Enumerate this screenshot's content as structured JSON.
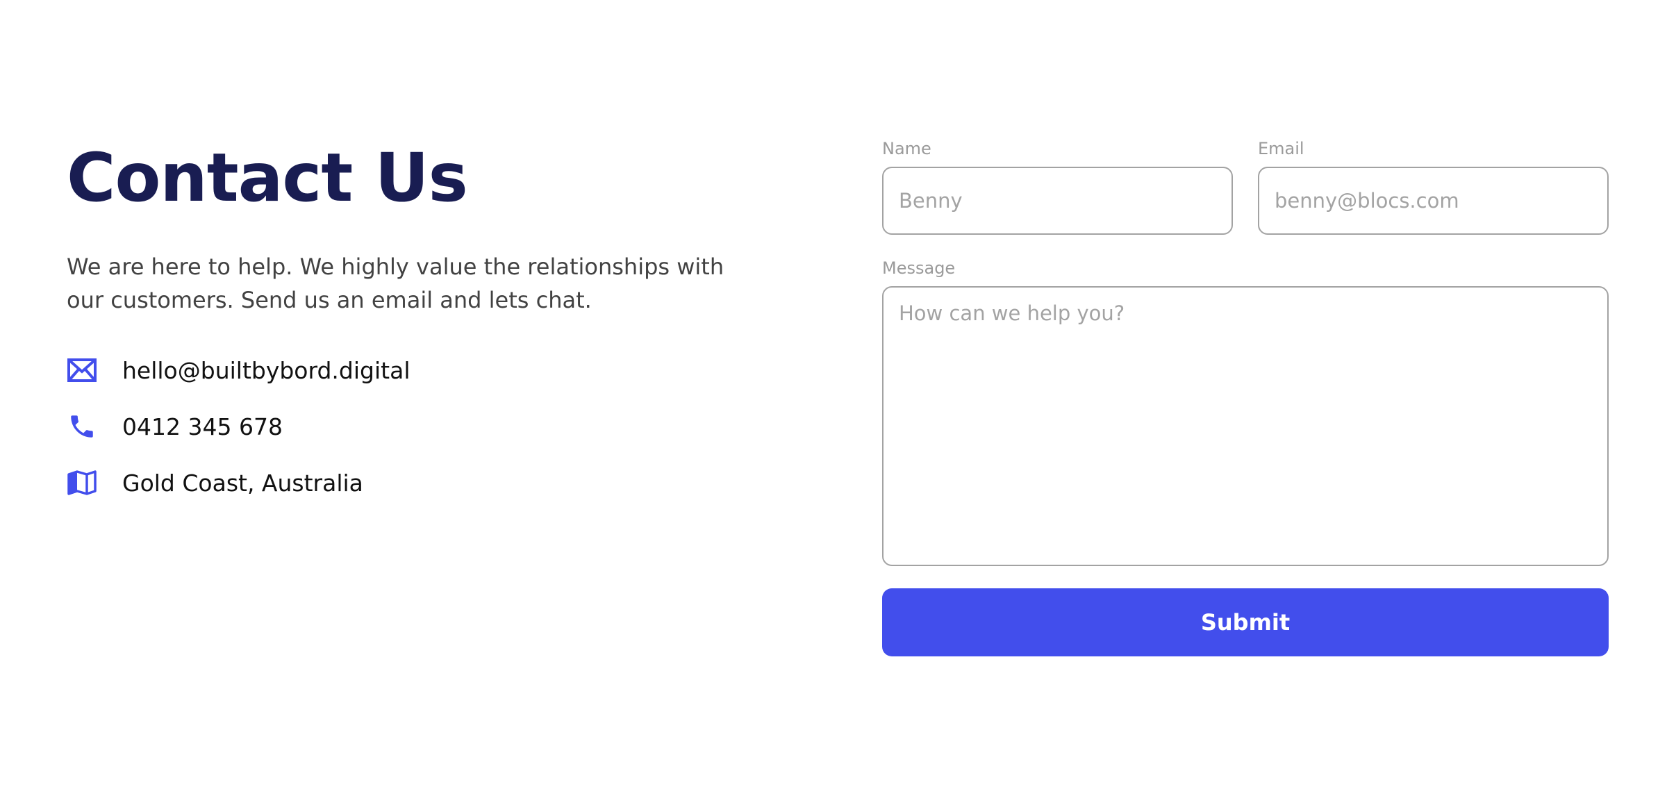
{
  "header": {
    "title": "Contact Us",
    "intro": "We are here to help. We highly value the relationships with our customers. Send us an email and lets chat."
  },
  "contact": {
    "items": [
      {
        "icon": "mail-icon",
        "text": "hello@builtbybord.digital"
      },
      {
        "icon": "phone-icon",
        "text": "0412 345 678"
      },
      {
        "icon": "map-icon",
        "text": "Gold Coast, Australia"
      }
    ]
  },
  "form": {
    "name": {
      "label": "Name",
      "placeholder": "Benny"
    },
    "email": {
      "label": "Email",
      "placeholder": "benny@blocs.com"
    },
    "message": {
      "label": "Message",
      "placeholder": "How can we help you?"
    },
    "submit_label": "Submit"
  },
  "colors": {
    "heading": "#191d52",
    "accent": "#424eec",
    "muted": "#a3a3a3"
  }
}
